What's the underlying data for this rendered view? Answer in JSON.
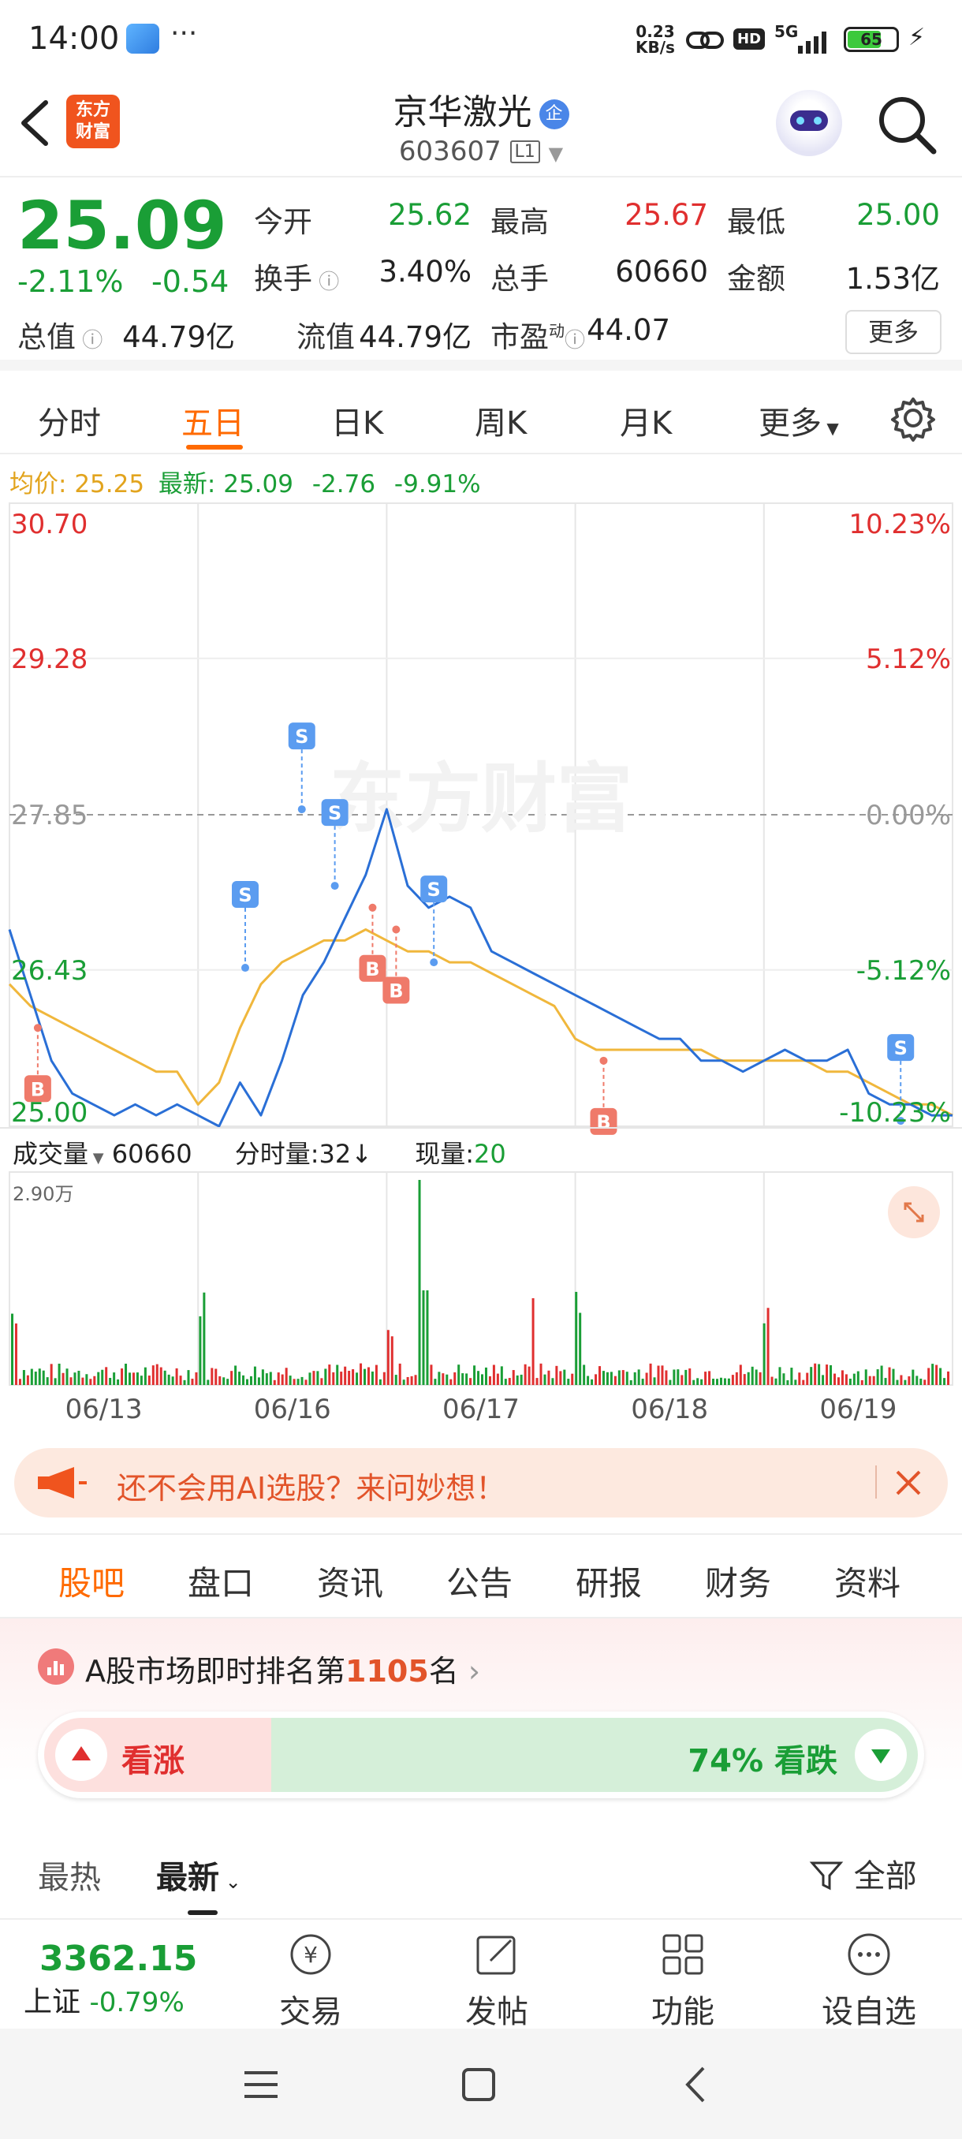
{
  "status": {
    "time": "14:00",
    "more": "···",
    "net_speed_value": "0.23",
    "net_speed_unit": "KB/s",
    "hd": "HD",
    "signal": "5G",
    "battery": "65"
  },
  "header": {
    "app_logo": "东方\n财富",
    "app_logo_line1": "东方",
    "app_logo_line2": "财富",
    "stock_name": "京华激光",
    "badge": "企",
    "stock_code": "603607",
    "level": "L1"
  },
  "quote": {
    "price": "25.09",
    "change_pct": "-2.11%",
    "change": "-0.54",
    "open_label": "今开",
    "open": "25.62",
    "high_label": "最高",
    "high": "25.67",
    "low_label": "最低",
    "low": "25.00",
    "turnover_label": "换手",
    "turnover": "3.40%",
    "volume_label": "总手",
    "volume": "60660",
    "amount_label": "金额",
    "amount": "1.53亿",
    "mktcap_label": "总值",
    "mktcap": "44.79亿",
    "float_label": "流值",
    "float": "44.79亿",
    "pe_label": "市盈",
    "pe_sup": "动",
    "pe": "44.07",
    "more_button": "更多"
  },
  "period_tabs": [
    "分时",
    "五日",
    "日K",
    "周K",
    "月K",
    "更多"
  ],
  "active_period": "五日",
  "chart_info": {
    "avg_label": "均价:",
    "avg_value": "25.25",
    "latest_label": "最新:",
    "latest_value": "25.09",
    "latest_change": "-2.76",
    "latest_pct": "-9.91%",
    "watermark": "东方财富"
  },
  "volume_info": {
    "label": "成交量",
    "value": "60660",
    "tick_label": "分时量:",
    "tick_value": "32",
    "tick_arrow": "↓",
    "now_label": "现量:",
    "now_value": "20",
    "max_label": "2.90万"
  },
  "chart_data": {
    "type": "line",
    "y_ticks": [
      "30.70",
      "29.28",
      "27.85",
      "26.43",
      "25.00"
    ],
    "y_pct_ticks": [
      "10.23%",
      "5.12%",
      "0.00%",
      "-5.12%",
      "-10.23%"
    ],
    "ylim": [
      25.0,
      30.7
    ],
    "reference_price": 27.85,
    "dates": [
      "06/13",
      "06/16",
      "06/17",
      "06/18",
      "06/19"
    ],
    "grid": true,
    "series": [
      {
        "values": [
          26.8,
          26.2,
          25.6,
          25.3,
          25.2,
          25.1,
          25.2,
          25.1,
          25.2,
          25.1,
          25.0,
          25.4,
          25.1,
          25.6,
          26.2,
          26.5,
          26.9,
          27.3,
          27.9,
          27.2,
          27.0,
          27.1,
          27.0,
          26.6,
          26.5,
          26.4,
          26.3,
          26.2,
          26.1,
          26.0,
          25.9,
          25.8,
          25.8,
          25.6,
          25.6,
          25.5,
          25.6,
          25.7,
          25.6,
          25.6,
          25.7,
          25.3,
          25.2,
          25.2,
          25.1,
          25.1
        ]
      },
      {
        "values": [
          26.3,
          26.1,
          26.0,
          25.9,
          25.8,
          25.7,
          25.6,
          25.5,
          25.5,
          25.2,
          25.4,
          25.9,
          26.3,
          26.5,
          26.6,
          26.7,
          26.7,
          26.8,
          26.7,
          26.6,
          26.6,
          26.5,
          26.5,
          26.4,
          26.3,
          26.2,
          26.1,
          25.8,
          25.7,
          25.7,
          25.7,
          25.7,
          25.7,
          25.7,
          25.6,
          25.6,
          25.6,
          25.6,
          25.6,
          25.5,
          25.5,
          25.4,
          25.3,
          25.2,
          25.2,
          25.1
        ]
      }
    ],
    "signals": [
      {
        "label": "B",
        "x_frac": 0.03,
        "price": 25.9
      },
      {
        "label": "S",
        "x_frac": 0.25,
        "price": 26.45
      },
      {
        "label": "S",
        "x_frac": 0.31,
        "price": 27.9
      },
      {
        "label": "S",
        "x_frac": 0.345,
        "price": 27.2
      },
      {
        "label": "B",
        "x_frac": 0.385,
        "price": 27.0
      },
      {
        "label": "B",
        "x_frac": 0.41,
        "price": 26.8
      },
      {
        "label": "S",
        "x_frac": 0.45,
        "price": 26.5
      },
      {
        "label": "B",
        "x_frac": 0.63,
        "price": 25.6
      },
      {
        "label": "S",
        "x_frac": 0.945,
        "price": 25.05
      }
    ]
  },
  "banner": {
    "text": "还不会用AI选股？来问妙想！"
  },
  "info_tabs": [
    "股吧",
    "盘口",
    "资讯",
    "公告",
    "研报",
    "财务",
    "资料"
  ],
  "active_info_tab": "股吧",
  "rank": {
    "prefix": "A股市场即时排名第",
    "rank": "1105",
    "suffix": "名",
    "bull_label": "看涨",
    "bear_pct": "74%",
    "bear_label": "看跌",
    "bear_fraction": 0.74
  },
  "feed_tabs": {
    "hot": "最热",
    "latest": "最新",
    "filter": "全部"
  },
  "bottom_nav": {
    "index_value": "3362.15",
    "index_name": "上证",
    "index_change": "-0.79%",
    "items": [
      "交易",
      "发帖",
      "功能",
      "设自选"
    ]
  },
  "colors": {
    "up": "#e02f2f",
    "down": "#1a9e36",
    "accent": "#ff6a00",
    "price_line": "#2a6fd6",
    "avg_line": "#f0b73c"
  }
}
